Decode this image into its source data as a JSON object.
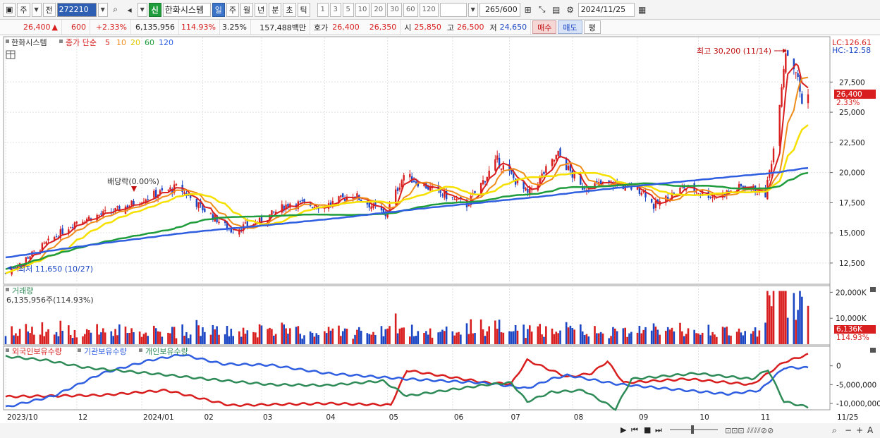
{
  "toolbar": {
    "period_select": "주",
    "prev_label": "전",
    "stock_code": "272210",
    "credit_badge": "신",
    "stock_name": "한화시스템",
    "period_tabs": [
      "일",
      "주",
      "월",
      "년",
      "분",
      "초",
      "틱"
    ],
    "active_period": "일",
    "interval_buttons": [
      "1",
      "3",
      "5",
      "10",
      "20",
      "30",
      "60",
      "120"
    ],
    "bar_count": "265",
    "bar_total": "/600",
    "date": "2024/11/25"
  },
  "quote": {
    "price": "26,400",
    "change_arrow": "▲",
    "change": "600",
    "change_pct": "+2.33%",
    "volume": "6,135,956",
    "volume_ratio": "114.93%",
    "turnover_pct": "3.25%",
    "trade_value": "157,488백만",
    "ask_label": "호가",
    "ask": "26,400",
    "bid": "26,350",
    "open_label": "시",
    "open": "25,850",
    "high_label": "고",
    "high": "26,500",
    "low_label": "저",
    "low": "24,650",
    "buy_button": "매수",
    "sell_button": "매도",
    "eval_button": "평"
  },
  "price_panel": {
    "legend_name": "한화시스템",
    "legend_indicator": "종가 단순",
    "ma_periods": [
      "5",
      "10",
      "20",
      "60",
      "120"
    ],
    "lc_label": "LC:126.61",
    "hc_label": "HC:-12.58",
    "high_annotation": "최고 30,200 (11/14)",
    "low_annotation": "최저 11,650 (10/27)",
    "dividend_annotation": "배당락(0.00%)",
    "current_price_tag": "26,400",
    "current_pct_tag": "2.33%"
  },
  "volume_panel": {
    "title": "거래량",
    "value": "6,135,956주(114.93%)",
    "current_tag": "6,136K",
    "current_pct_tag": "114.93%"
  },
  "holdings_panel": {
    "series_names": [
      "외국인보유수량",
      "기관보유수량",
      "개인보유수량"
    ]
  },
  "colors": {
    "up": "#d81e1e",
    "down": "#1b46c4",
    "ma5": "#d81e1e",
    "ma10": "#f08c1a",
    "ma20": "#f5e000",
    "ma60": "#1f9c3c",
    "ma120": "#2f5fe0",
    "foreign": "#d81e1e",
    "institution": "#2f5fe0",
    "individual": "#2e8b57"
  },
  "chart_data": [
    {
      "type": "line",
      "name": "daily price with moving averages",
      "x_labels": [
        "2023/10",
        "12",
        "2024/01",
        "02",
        "03",
        "04",
        "05",
        "06",
        "07",
        "08",
        "09",
        "10",
        "11",
        "11/25"
      ],
      "y_ticks": [
        "27,500",
        "25,000",
        "22,500",
        "20,000",
        "17,500",
        "15,000",
        "12,500"
      ],
      "ylim": [
        10800,
        31200
      ],
      "close_points": [
        {
          "x": "2023-10-27",
          "y": 11650
        },
        {
          "x": "2023-11-15",
          "y": 14000
        },
        {
          "x": "2023-12-01",
          "y": 16000
        },
        {
          "x": "2023-12-20",
          "y": 16800
        },
        {
          "x": "2024-01-05",
          "y": 18000
        },
        {
          "x": "2024-01-20",
          "y": 18800
        },
        {
          "x": "2024-02-01",
          "y": 17000
        },
        {
          "x": "2024-02-15",
          "y": 15200
        },
        {
          "x": "2024-03-01",
          "y": 16000
        },
        {
          "x": "2024-03-15",
          "y": 17500
        },
        {
          "x": "2024-04-01",
          "y": 17200
        },
        {
          "x": "2024-04-15",
          "y": 18200
        },
        {
          "x": "2024-05-01",
          "y": 16500
        },
        {
          "x": "2024-05-10",
          "y": 19800
        },
        {
          "x": "2024-05-25",
          "y": 18500
        },
        {
          "x": "2024-06-10",
          "y": 17300
        },
        {
          "x": "2024-06-25",
          "y": 21000
        },
        {
          "x": "2024-07-10",
          "y": 18200
        },
        {
          "x": "2024-07-25",
          "y": 21500
        },
        {
          "x": "2024-08-05",
          "y": 18800
        },
        {
          "x": "2024-08-20",
          "y": 19100
        },
        {
          "x": "2024-09-05",
          "y": 18500
        },
        {
          "x": "2024-09-10",
          "y": 17200
        },
        {
          "x": "2024-09-25",
          "y": 18800
        },
        {
          "x": "2024-10-10",
          "y": 18000
        },
        {
          "x": "2024-10-25",
          "y": 18900
        },
        {
          "x": "2024-11-04",
          "y": 18200
        },
        {
          "x": "2024-11-08",
          "y": 22000
        },
        {
          "x": "2024-11-14",
          "y": 30200
        },
        {
          "x": "2024-11-19",
          "y": 28500
        },
        {
          "x": "2024-11-22",
          "y": 25800
        },
        {
          "x": "2024-11-25",
          "y": 26400
        }
      ],
      "ma_last": {
        "ma20": 23500,
        "ma60": 20200,
        "ma120": 19400
      },
      "grid": true
    },
    {
      "type": "bar",
      "name": "거래량",
      "y_ticks": [
        "20,000K",
        "10,000K"
      ],
      "ylim": [
        0,
        22000000
      ],
      "last_value": 6135956
    },
    {
      "type": "line",
      "name": "보유수량",
      "y_ticks": [
        "0",
        "-5,000,000",
        "-10,000,000"
      ],
      "ylim": [
        -11500000,
        3500000
      ],
      "series": [
        {
          "name": "외국인보유수량",
          "last_value": 2200000
        },
        {
          "name": "기관보유수량",
          "last_value": 0
        },
        {
          "name": "개인보유수량",
          "last_value": -11000000
        }
      ]
    }
  ]
}
